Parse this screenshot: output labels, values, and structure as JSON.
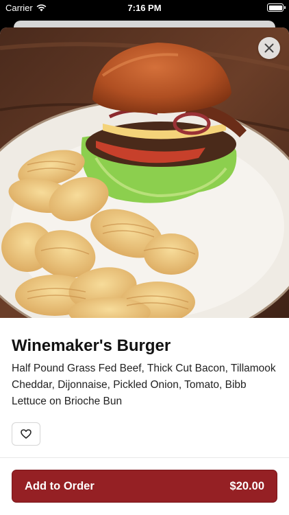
{
  "status_bar": {
    "carrier": "Carrier",
    "time": "7:16 PM"
  },
  "item": {
    "title": "Winemaker's Burger",
    "description": "Half Pound Grass Fed Beef, Thick Cut Bacon, Tillamook Cheddar, Dijonnaise, Pickled Onion, Tomato, Bibb Lettuce on Brioche Bun"
  },
  "order_button": {
    "label": "Add to Order",
    "price": "$20.00"
  },
  "colors": {
    "accent": "#952024",
    "background": "#ffffff"
  },
  "icons": {
    "close": "close-icon",
    "favorite": "heart-outline-icon",
    "wifi": "wifi-icon",
    "battery": "battery-icon"
  }
}
